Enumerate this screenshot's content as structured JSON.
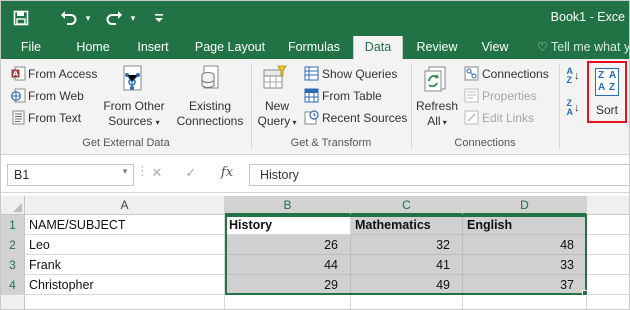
{
  "window": {
    "title": "Book1 - Exce"
  },
  "quick_access": {
    "save_icon": "save-icon",
    "undo_icon": "undo-icon",
    "redo_icon": "redo-icon",
    "customize_icon": "customize-icon"
  },
  "tabs": [
    {
      "label": "File"
    },
    {
      "label": "Home"
    },
    {
      "label": "Insert"
    },
    {
      "label": "Page Layout"
    },
    {
      "label": "Formulas"
    },
    {
      "label": "Data"
    },
    {
      "label": "Review"
    },
    {
      "label": "View"
    }
  ],
  "tell_me": {
    "label": "Tell me what y"
  },
  "ribbon": {
    "get_external": {
      "from_access": "From Access",
      "from_web": "From Web",
      "from_text": "From Text",
      "from_other_1": "From Other",
      "from_other_2": "Sources",
      "existing_1": "Existing",
      "existing_2": "Connections",
      "group_label": "Get External Data"
    },
    "get_transform": {
      "new_query_1": "New",
      "new_query_2": "Query",
      "show_queries": "Show Queries",
      "from_table": "From Table",
      "recent_sources": "Recent Sources",
      "group_label": "Get & Transform"
    },
    "connections": {
      "refresh_1": "Refresh",
      "refresh_2": "All",
      "connections": "Connections",
      "properties": "Properties",
      "edit_links": "Edit Links",
      "group_label": "Connections"
    },
    "sort": {
      "sort_label": "Sort",
      "icon_az_top": "A",
      "icon_az_bottom": "Z",
      "icon_za_top": "Z",
      "icon_za_bottom": "A"
    }
  },
  "formula_bar": {
    "name_box": "B1",
    "cancel": "✕",
    "enter": "✓",
    "fx": "fx",
    "content": "History"
  },
  "sheet": {
    "columns": [
      "A",
      "B",
      "C",
      "D"
    ],
    "rows": [
      "1",
      "2",
      "3",
      "4"
    ],
    "cells": [
      [
        "NAME/SUBJECT",
        "History",
        "Mathematics",
        "English"
      ],
      [
        "Leo",
        "26",
        "32",
        "48"
      ],
      [
        "Frank",
        "44",
        "41",
        "33"
      ],
      [
        "Christopher",
        "29",
        "49",
        "37"
      ]
    ]
  },
  "colors": {
    "excel_green": "#217346",
    "selection_shade": "#d0d0d0",
    "highlight_red": "#e81123"
  }
}
